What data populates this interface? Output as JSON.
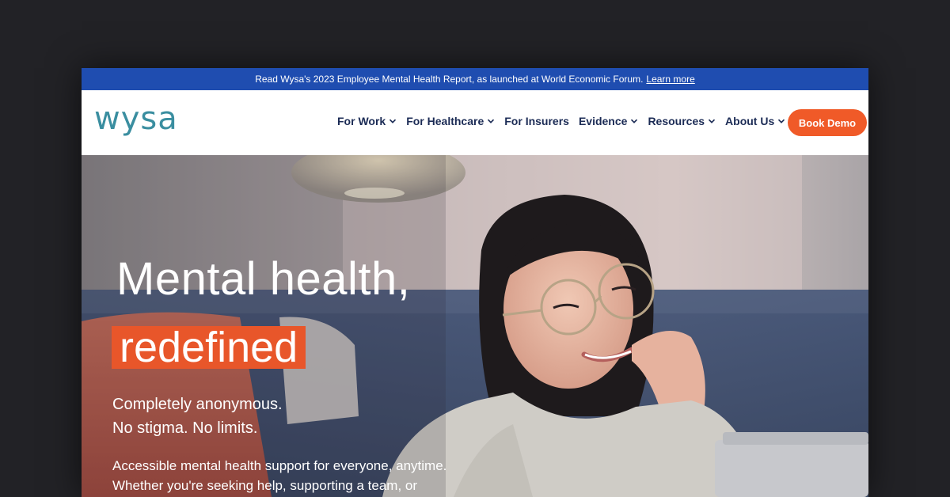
{
  "banner": {
    "text": "Read Wysa's 2023 Employee Mental Health Report, as launched at World Economic Forum.",
    "link": "Learn more"
  },
  "logo": {
    "text": "wysa"
  },
  "nav": {
    "items": [
      {
        "label": "For Work",
        "dropdown": true
      },
      {
        "label": "For Healthcare",
        "dropdown": true
      },
      {
        "label": "For Insurers",
        "dropdown": false
      },
      {
        "label": "Evidence",
        "dropdown": true
      },
      {
        "label": "Resources",
        "dropdown": true
      },
      {
        "label": "About Us",
        "dropdown": true
      }
    ],
    "cta": "Book Demo"
  },
  "hero": {
    "title": "Mental health,",
    "highlight": "redefined",
    "sub_line1": "Completely anonymous.",
    "sub_line2": "No stigma. No limits.",
    "body_line1": "Accessible mental health support for everyone, anytime.",
    "body_line2": "Whether you're seeking help, supporting a team, or"
  },
  "colors": {
    "banner_bg": "#1f4db0",
    "logo": "#3a8ea0",
    "nav_text": "#1b2b55",
    "cta_bg": "#f05a28",
    "highlight_bg": "#e8562a"
  }
}
